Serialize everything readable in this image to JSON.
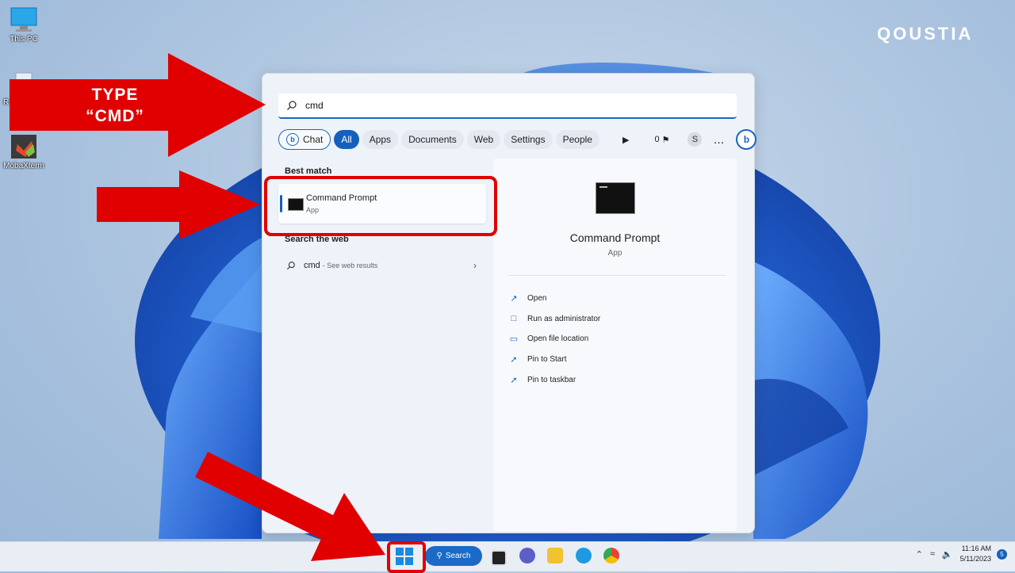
{
  "brand": {
    "name": "QOUSTIA"
  },
  "desktop": {
    "icons": [
      {
        "label": "This PC",
        "icon": "computer-icon"
      },
      {
        "label": "R",
        "icon": "recycle-bin-icon"
      },
      {
        "label": "MobaXterm",
        "icon": "mobaxterm-icon"
      }
    ]
  },
  "annotation": {
    "type_label": "TYPE “CMD”"
  },
  "search": {
    "value": "cmd",
    "filters": [
      "Chat",
      "All",
      "Apps",
      "Documents",
      "Web",
      "Settings",
      "People"
    ],
    "points": "0",
    "avatar_initial": "S",
    "more": "…",
    "bing": "b"
  },
  "best_match": {
    "heading": "Best match",
    "name": "Command Prompt",
    "type": "App"
  },
  "web": {
    "heading": "Search the web",
    "query": "cmd",
    "suffix": "- See web results"
  },
  "details": {
    "title": "Command Prompt",
    "subtitle": "App",
    "actions": [
      {
        "label": "Open",
        "icon": "open-icon"
      },
      {
        "label": "Run as administrator",
        "icon": "shield-icon"
      },
      {
        "label": "Open file location",
        "icon": "folder-icon"
      },
      {
        "label": "Pin to Start",
        "icon": "pin-icon"
      },
      {
        "label": "Pin to taskbar",
        "icon": "pin-icon"
      }
    ]
  },
  "taskbar": {
    "search_label": "Search",
    "time": "11:16 AM",
    "date": "5/11/2023",
    "notification_count": "5"
  },
  "colors": {
    "accent": "#1660bb",
    "annotation_red": "#e00000"
  }
}
